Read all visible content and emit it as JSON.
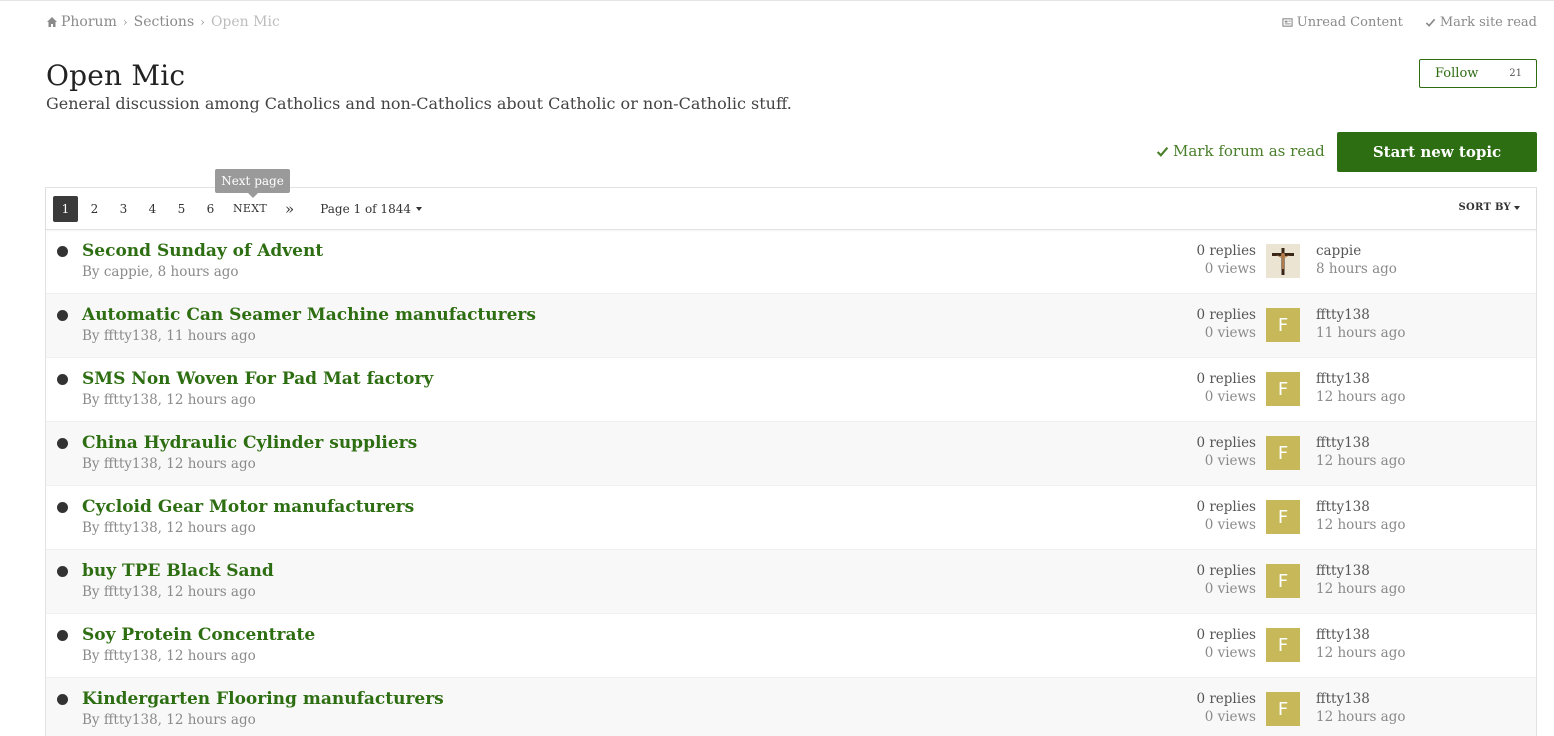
{
  "breadcrumb": [
    {
      "label": "Phorum",
      "icon": "home-icon"
    },
    {
      "label": "Sections"
    },
    {
      "label": "Open Mic"
    }
  ],
  "top_links": {
    "unread": "Unread Content",
    "mark_site": "Mark site read"
  },
  "header": {
    "title": "Open Mic",
    "description": "General discussion among Catholics and non-Catholics about Catholic or non-Catholic stuff.",
    "follow_label": "Follow",
    "follow_count": "21",
    "mark_forum": "Mark forum as read",
    "new_topic": "Start new topic"
  },
  "pager": {
    "tooltip": "Next page",
    "pages": [
      "1",
      "2",
      "3",
      "4",
      "5",
      "6"
    ],
    "next": "NEXT",
    "last": "»",
    "jump": "Page 1 of 1844",
    "sort": "SORT BY"
  },
  "topics": [
    {
      "title": "Second Sunday of Advent",
      "author": "By cappie, 8 hours ago",
      "replies": "0 replies",
      "views": "0 views",
      "avatar": "",
      "last_user": "cappie",
      "last_time": "8 hours ago"
    },
    {
      "title": "Automatic Can Seamer Machine manufacturers",
      "author": "By fftty138, 11 hours ago",
      "replies": "0 replies",
      "views": "0 views",
      "avatar": "F",
      "last_user": "fftty138",
      "last_time": "11 hours ago"
    },
    {
      "title": "SMS Non Woven For Pad Mat factory",
      "author": "By fftty138, 12 hours ago",
      "replies": "0 replies",
      "views": "0 views",
      "avatar": "F",
      "last_user": "fftty138",
      "last_time": "12 hours ago"
    },
    {
      "title": "China Hydraulic Cylinder suppliers",
      "author": "By fftty138, 12 hours ago",
      "replies": "0 replies",
      "views": "0 views",
      "avatar": "F",
      "last_user": "fftty138",
      "last_time": "12 hours ago"
    },
    {
      "title": "Cycloid Gear Motor manufacturers",
      "author": "By fftty138, 12 hours ago",
      "replies": "0 replies",
      "views": "0 views",
      "avatar": "F",
      "last_user": "fftty138",
      "last_time": "12 hours ago"
    },
    {
      "title": "buy TPE Black Sand",
      "author": "By fftty138, 12 hours ago",
      "replies": "0 replies",
      "views": "0 views",
      "avatar": "F",
      "last_user": "fftty138",
      "last_time": "12 hours ago"
    },
    {
      "title": "Soy Protein Concentrate",
      "author": "By fftty138, 12 hours ago",
      "replies": "0 replies",
      "views": "0 views",
      "avatar": "F",
      "last_user": "fftty138",
      "last_time": "12 hours ago"
    },
    {
      "title": "Kindergarten Flooring manufacturers",
      "author": "By fftty138, 12 hours ago",
      "replies": "0 replies",
      "views": "0 views",
      "avatar": "F",
      "last_user": "fftty138",
      "last_time": "12 hours ago"
    }
  ]
}
